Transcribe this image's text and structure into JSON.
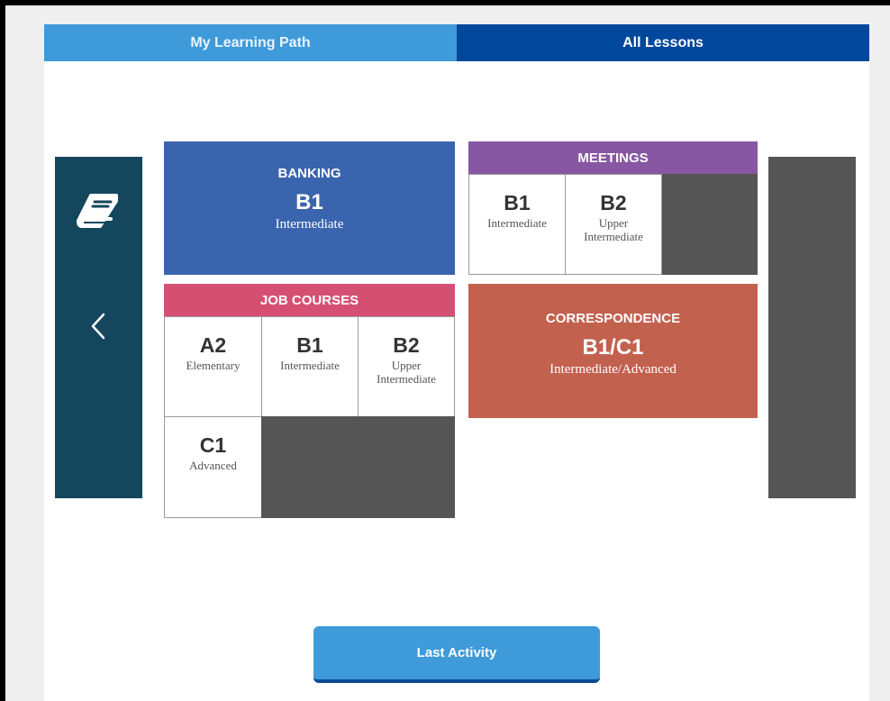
{
  "tabs": {
    "learning_path": "My Learning Path",
    "all_lessons": "All Lessons"
  },
  "icons": {
    "book": "book-icon",
    "prev": "chevron-left-icon"
  },
  "cards": {
    "banking": {
      "name": "BANKING",
      "code": "B1",
      "desc": "Intermediate",
      "color": "#3a64ae"
    },
    "correspondence": {
      "name": "CORRESPONDENCE",
      "code": "B1/C1",
      "desc": "Intermediate/Advanced",
      "color": "#c3614f"
    }
  },
  "meetings": {
    "name": "MEETINGS",
    "color": "#8757a3",
    "levels": [
      {
        "code": "B1",
        "desc": "Intermediate"
      },
      {
        "code": "B2",
        "desc": "Upper Intermediate"
      }
    ]
  },
  "job_courses": {
    "name": "JOB COURSES",
    "color": "#d54f73",
    "levels": [
      {
        "code": "A2",
        "desc": "Elementary"
      },
      {
        "code": "B1",
        "desc": "Intermediate"
      },
      {
        "code": "B2",
        "desc": "Upper Intermediate"
      },
      {
        "code": "C1",
        "desc": "Advanced"
      }
    ]
  },
  "footer": {
    "last_activity": "Last Activity"
  },
  "colors": {
    "tab_active": "#3f9ad9",
    "tab_dark": "#01479c",
    "side_panel": "#14465e",
    "placeholder": "#555555"
  }
}
